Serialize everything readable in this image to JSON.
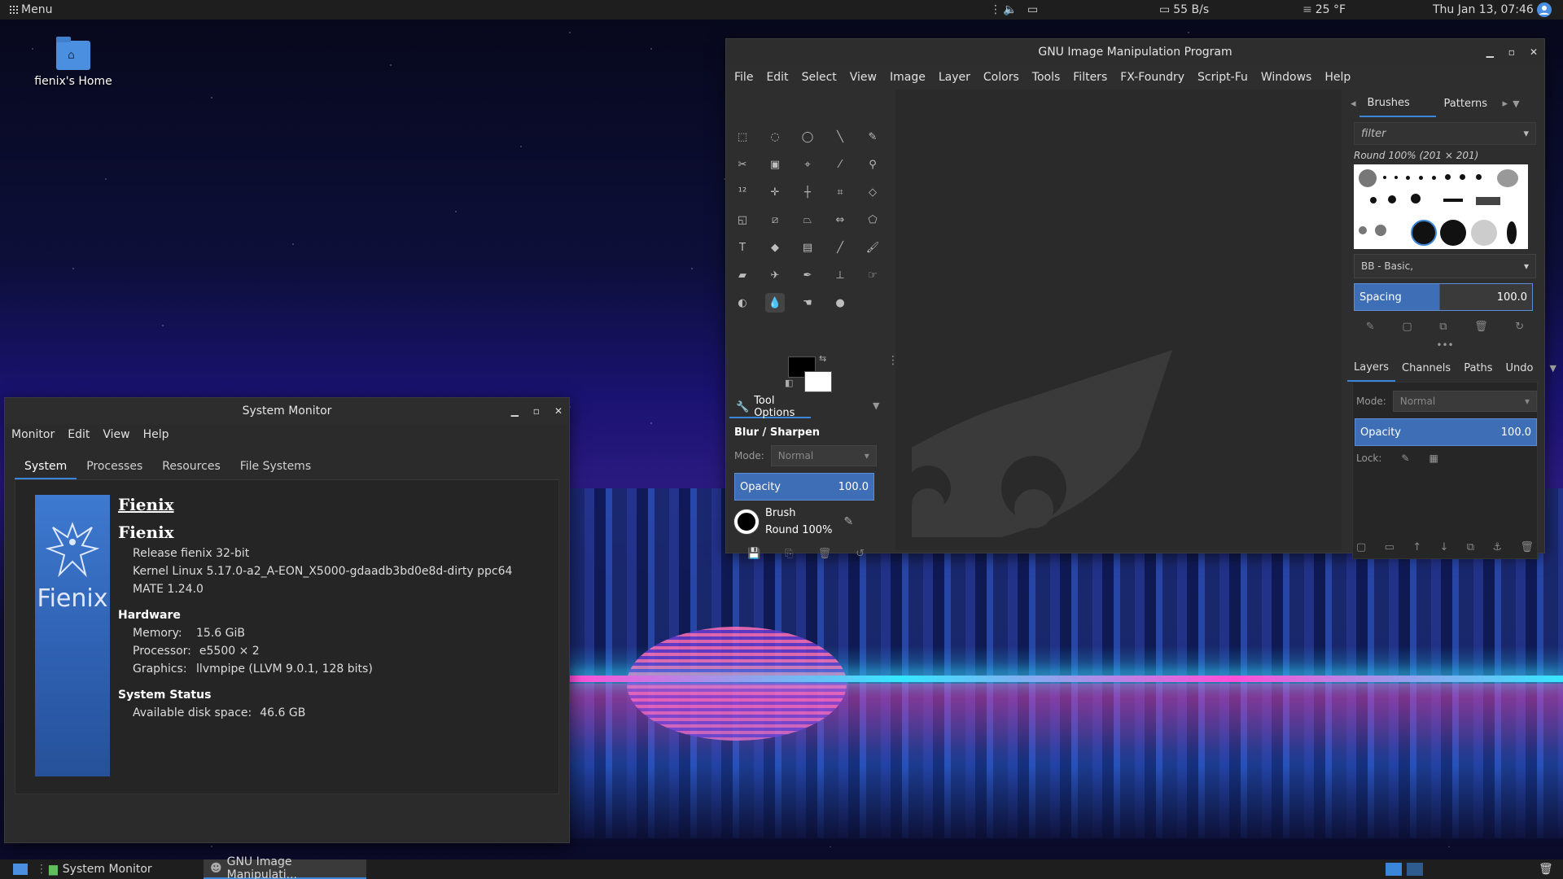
{
  "top_panel": {
    "menu_label": "Menu",
    "network_speed": "55 B/s",
    "weather": "25 °F",
    "clock": "Thu Jan 13, 07:46"
  },
  "desktop": {
    "home_icon_label": "fienix's Home"
  },
  "system_monitor": {
    "title": "System Monitor",
    "menu": [
      "Monitor",
      "Edit",
      "View",
      "Help"
    ],
    "tabs": [
      "System",
      "Processes",
      "Resources",
      "File Systems"
    ],
    "active_tab": "System",
    "logo_text": "Fienix",
    "distro_link": "Fienix",
    "distro_name": "Fienix",
    "release": "Release fienix 32-bit",
    "kernel": "Kernel Linux 5.17.0-a2_A-EON_X5000-gdaadb3bd0e8d-dirty ppc64",
    "desktop_env": "MATE 1.24.0",
    "hardware_heading": "Hardware",
    "memory_label": "Memory:",
    "memory_value": "15.6 GiB",
    "processor_label": "Processor:",
    "processor_value": "e5500 × 2",
    "graphics_label": "Graphics:",
    "graphics_value": "llvmpipe (LLVM 9.0.1, 128 bits)",
    "status_heading": "System Status",
    "disk_label": "Available disk space:",
    "disk_value": "46.6 GB"
  },
  "gimp": {
    "title": "GNU Image Manipulation Program",
    "menu": [
      "File",
      "Edit",
      "Select",
      "View",
      "Image",
      "Layer",
      "Colors",
      "Tools",
      "Filters",
      "FX-Foundry",
      "Script-Fu",
      "Windows",
      "Help"
    ],
    "tool_options_tab": "Tool Options",
    "tool_name": "Blur / Sharpen",
    "mode_label": "Mode:",
    "mode_value": "Normal",
    "opacity_label": "Opacity",
    "opacity_value": "100.0",
    "brush_label": "Brush",
    "brush_value": "Round 100%",
    "dock_tabs": [
      "Brushes",
      "Patterns"
    ],
    "filter_placeholder": "filter",
    "brush_selected": "Round 100% (201 × 201)",
    "brush_tag": "BB - Basic,",
    "spacing_label": "Spacing",
    "spacing_value": "100.0",
    "layer_tabs": [
      "Layers",
      "Channels",
      "Paths",
      "Undo"
    ],
    "layers_mode_label": "Mode:",
    "layers_mode_value": "Normal",
    "layers_opacity_label": "Opacity",
    "layers_opacity_value": "100.0",
    "lock_label": "Lock:"
  },
  "taskbar": {
    "items": [
      "System Monitor",
      "GNU Image Manipulati..."
    ]
  },
  "colors": {
    "accent": "#3a86d8",
    "fg_color": "#000000",
    "bg_color": "#ffffff"
  }
}
